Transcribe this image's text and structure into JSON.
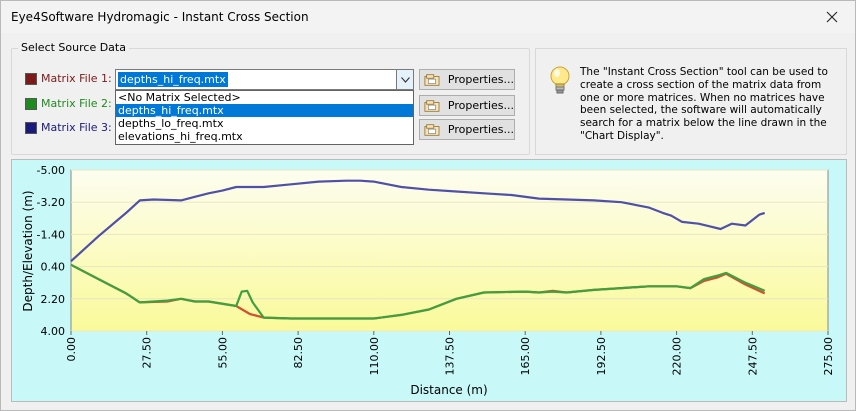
{
  "window": {
    "title": "Eye4Software Hydromagic - Instant Cross Section",
    "close_icon": "close-icon"
  },
  "source_group": {
    "title": "Select Source Data",
    "rows": [
      {
        "label": "Matrix File 1:",
        "color": "#7a1a1a"
      },
      {
        "label": "Matrix File 2:",
        "color": "#1f8a1f"
      },
      {
        "label": "Matrix File 3:",
        "color": "#1a1a7a"
      }
    ],
    "combo_value": "depths_hi_freq.mtx",
    "dropdown_options": [
      "<No Matrix Selected>",
      "depths_hi_freq.mtx",
      "depths_lo_freq.mtx",
      "elevations_hi_freq.mtx"
    ],
    "selected_option_index": 1,
    "properties_label": "Properties..."
  },
  "info": {
    "text": "The \"Instant Cross Section\" tool can be used to create a cross section of the matrix data from one or more matrices. When no matrices have been selected, the software will automatically search for a matrix below the line drawn in the \"Chart Display\"."
  },
  "chart_data": {
    "type": "line",
    "xlabel": "Distance (m)",
    "ylabel": "Depth/Elevation (m)",
    "xlim": [
      0,
      275
    ],
    "ylim": [
      -5.0,
      4.0
    ],
    "y_inverted": true,
    "x_ticks": [
      "0.00",
      "27.50",
      "55.00",
      "82.50",
      "110.00",
      "137.50",
      "165.00",
      "192.50",
      "220.00",
      "247.50",
      "275.00"
    ],
    "y_ticks": [
      "-5.00",
      "-3.20",
      "-1.40",
      "0.40",
      "2.20",
      "4.00"
    ],
    "series": [
      {
        "color": "#5050a8",
        "x": [
          0,
          10,
          20,
          25,
          30,
          40,
          45,
          50,
          55,
          60,
          65,
          70,
          80,
          90,
          100,
          105,
          110,
          115,
          120,
          130,
          140,
          150,
          160,
          170,
          180,
          190,
          200,
          210,
          215,
          218,
          222,
          228,
          232,
          236,
          240,
          245,
          250,
          252
        ],
        "y": [
          0.1,
          -1.3,
          -2.6,
          -3.3,
          -3.35,
          -3.3,
          -3.5,
          -3.7,
          -3.85,
          -4.05,
          -4.05,
          -4.05,
          -4.2,
          -4.35,
          -4.4,
          -4.4,
          -4.35,
          -4.2,
          -4.05,
          -3.9,
          -3.8,
          -3.7,
          -3.6,
          -3.4,
          -3.35,
          -3.3,
          -3.2,
          -2.9,
          -2.6,
          -2.45,
          -2.1,
          -2.0,
          -1.85,
          -1.7,
          -2.0,
          -1.9,
          -2.5,
          -2.6
        ]
      },
      {
        "color": "#d05030",
        "x": [
          0,
          10,
          20,
          25,
          35,
          40,
          45,
          50,
          60,
          65,
          70,
          80,
          90,
          100,
          110,
          120,
          130,
          140,
          150,
          165,
          170,
          175,
          180,
          190,
          200,
          210,
          220,
          225,
          230,
          235,
          238,
          245,
          252
        ],
        "y": [
          0.3,
          1.1,
          1.9,
          2.4,
          2.35,
          2.2,
          2.35,
          2.35,
          2.6,
          3.05,
          3.25,
          3.3,
          3.3,
          3.3,
          3.3,
          3.1,
          2.8,
          2.2,
          1.85,
          1.8,
          1.85,
          1.75,
          1.85,
          1.7,
          1.6,
          1.5,
          1.5,
          1.6,
          1.2,
          1.0,
          0.8,
          1.4,
          1.9
        ]
      },
      {
        "color": "#40a040",
        "x": [
          0,
          10,
          20,
          25,
          35,
          40,
          45,
          50,
          60,
          62,
          64,
          66,
          70,
          80,
          90,
          100,
          110,
          120,
          130,
          140,
          150,
          165,
          170,
          175,
          180,
          190,
          200,
          210,
          220,
          225,
          230,
          235,
          238,
          245,
          252
        ],
        "y": [
          0.3,
          1.1,
          1.9,
          2.4,
          2.3,
          2.2,
          2.35,
          2.35,
          2.6,
          1.8,
          1.75,
          2.4,
          3.25,
          3.3,
          3.3,
          3.3,
          3.3,
          3.1,
          2.8,
          2.2,
          1.85,
          1.8,
          1.85,
          1.8,
          1.85,
          1.7,
          1.6,
          1.5,
          1.5,
          1.6,
          1.1,
          0.9,
          0.75,
          1.3,
          1.75
        ]
      }
    ]
  }
}
